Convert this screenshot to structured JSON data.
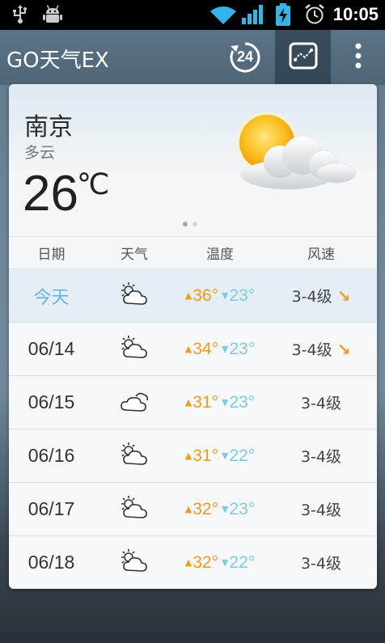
{
  "status_bar": {
    "time": "10:05",
    "icons": [
      "usb-icon",
      "android-debug-icon",
      "wifi-icon",
      "signal-icon",
      "battery-charging-icon",
      "alarm-icon"
    ]
  },
  "action_bar": {
    "title": "GO天气EX",
    "refresh_badge": "24",
    "buttons": [
      "refresh-24h-icon",
      "trend-chart-icon",
      "overflow-menu-icon"
    ]
  },
  "current": {
    "city": "南京",
    "condition": "多云",
    "temperature": "26",
    "unit": "℃",
    "icon": "sun-cloud-icon",
    "page_indicator": {
      "count": 2,
      "active": 0
    }
  },
  "table": {
    "headers": [
      "日期",
      "天气",
      "温度",
      "风速"
    ],
    "rows": [
      {
        "date": "今天",
        "icon": "partly-cloudy-icon",
        "high": "36°",
        "low": "23°",
        "wind": "3-4级",
        "wind_dir": "↘"
      },
      {
        "date": "06/14",
        "icon": "partly-cloudy-icon",
        "high": "34°",
        "low": "23°",
        "wind": "3-4级",
        "wind_dir": "↘"
      },
      {
        "date": "06/15",
        "icon": "cloudy-icon",
        "high": "31°",
        "low": "23°",
        "wind": "3-4级",
        "wind_dir": ""
      },
      {
        "date": "06/16",
        "icon": "partly-cloudy-icon",
        "high": "31°",
        "low": "22°",
        "wind": "3-4级",
        "wind_dir": ""
      },
      {
        "date": "06/17",
        "icon": "partly-cloudy-icon",
        "high": "32°",
        "low": "23°",
        "wind": "3-4级",
        "wind_dir": ""
      },
      {
        "date": "06/18",
        "icon": "partly-cloudy-icon",
        "high": "32°",
        "low": "22°",
        "wind": "3-4级",
        "wind_dir": ""
      }
    ]
  },
  "colors": {
    "high_temp": "#f29a1c",
    "low_temp": "#7ecbe8",
    "today": "#66b3e0",
    "action_bar": "#566e80"
  }
}
